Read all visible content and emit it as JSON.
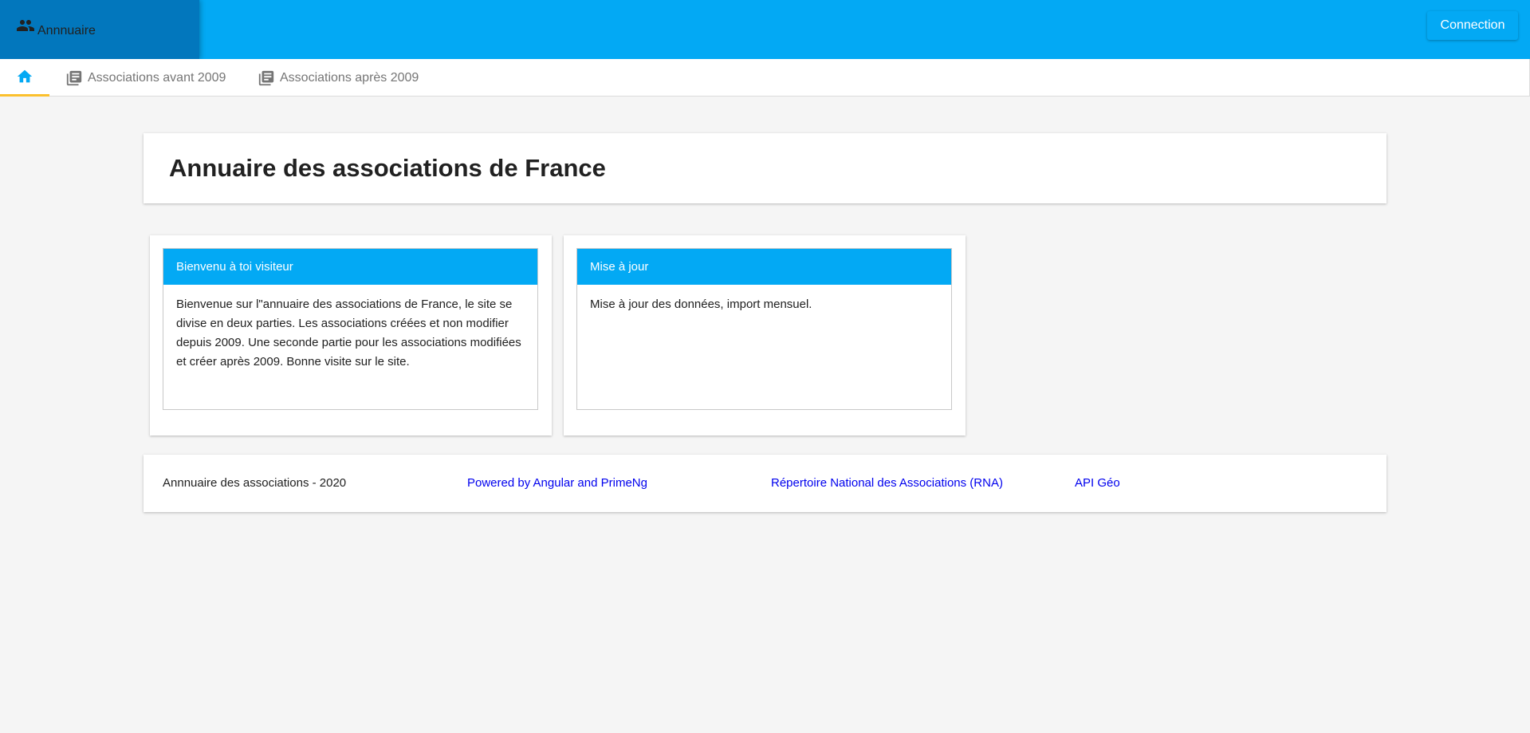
{
  "header": {
    "brand_label": "Annnuaire",
    "connect_label": "Connection",
    "accent_color": "#03a9f4",
    "brand_color": "#0277bd"
  },
  "tabs": [
    {
      "icon": "home-icon",
      "label": ""
    },
    {
      "icon": "library-books-icon",
      "label": "Associations avant 2009"
    },
    {
      "icon": "library-books-icon",
      "label": "Associations après 2009"
    }
  ],
  "main": {
    "title": "Annuaire des associations de France",
    "panels": [
      {
        "header": "Bienvenu à toi visiteur",
        "body": "Bienvenue sur l''annuaire des associations de France, le site se divise en deux parties. Les associations créées et non modifier depuis 2009. Une seconde partie pour les associations modifiées et créer après 2009. Bonne visite sur le site."
      },
      {
        "header": "Mise à jour",
        "body": "Mise à jour des données, import mensuel."
      }
    ]
  },
  "footer": {
    "copyright": "Annnuaire des associations - 2020",
    "links": [
      "Powered by Angular and PrimeNg",
      "Répertoire National des Associations (RNA)",
      "API Géo"
    ]
  }
}
